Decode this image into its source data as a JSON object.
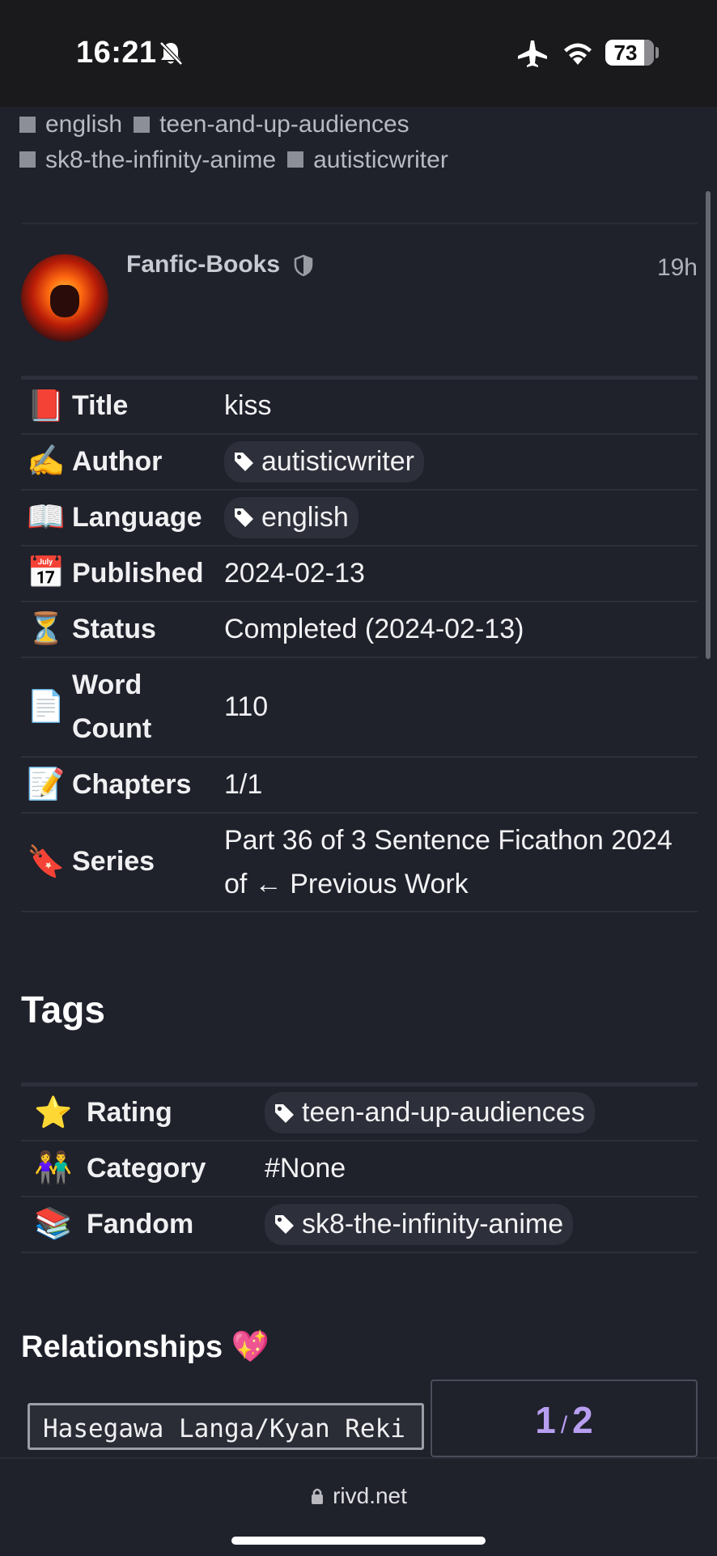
{
  "status_bar": {
    "time": "16:21",
    "battery": "73",
    "icons": [
      "bell-slash-icon",
      "airplane-icon",
      "wifi-icon",
      "battery-icon"
    ]
  },
  "top_tags": [
    "english",
    "teen-and-up-audiences",
    "sk8-the-infinity-anime",
    "autisticwriter"
  ],
  "post": {
    "username": "Fanfic-Books",
    "time_ago": "19h"
  },
  "info_rows": [
    {
      "icon": "📕",
      "icon_name": "book-icon",
      "label": "Title",
      "value": "kiss",
      "chip": false
    },
    {
      "icon": "✍️",
      "icon_name": "writing-hand-icon",
      "label": "Author",
      "value": "autisticwriter",
      "chip": true
    },
    {
      "icon": "📖",
      "icon_name": "open-book-icon",
      "label": "Language",
      "value": "english",
      "chip": true
    },
    {
      "icon": "📅",
      "icon_name": "calendar-icon",
      "label": "Published",
      "value": "2024-02-13",
      "chip": false
    },
    {
      "icon": "⏳",
      "icon_name": "hourglass-icon",
      "label": "Status",
      "value": "Completed (2024-02-13)",
      "chip": false
    },
    {
      "icon": "📄",
      "icon_name": "page-icon",
      "label": "Word Count",
      "value": "110",
      "chip": false
    },
    {
      "icon": "📝",
      "icon_name": "memo-icon",
      "label": "Chapters",
      "value": "1/1",
      "chip": false
    },
    {
      "icon": "🔖",
      "icon_name": "bookmark-icon",
      "label": "Series",
      "value": "Part 36 of 3 Sentence Ficathon 2024 of ← Previous Work",
      "chip": false
    }
  ],
  "tags_heading": "Tags",
  "tag_rows": [
    {
      "icon": "⭐",
      "icon_name": "star-icon",
      "label": "Rating",
      "value": "teen-and-up-audiences",
      "chip": true
    },
    {
      "icon": "👫",
      "icon_name": "couple-icon",
      "label": "Category",
      "value": "#None",
      "chip": false
    },
    {
      "icon": "📚",
      "icon_name": "books-icon",
      "label": "Fandom",
      "value": "sk8-the-infinity-anime",
      "chip": true
    }
  ],
  "relationships_heading": "Relationships 💖",
  "relationship": "Hasegawa Langa/Kyan Reki",
  "pager": {
    "current": "1",
    "total": "2"
  },
  "url": "rivd.net"
}
